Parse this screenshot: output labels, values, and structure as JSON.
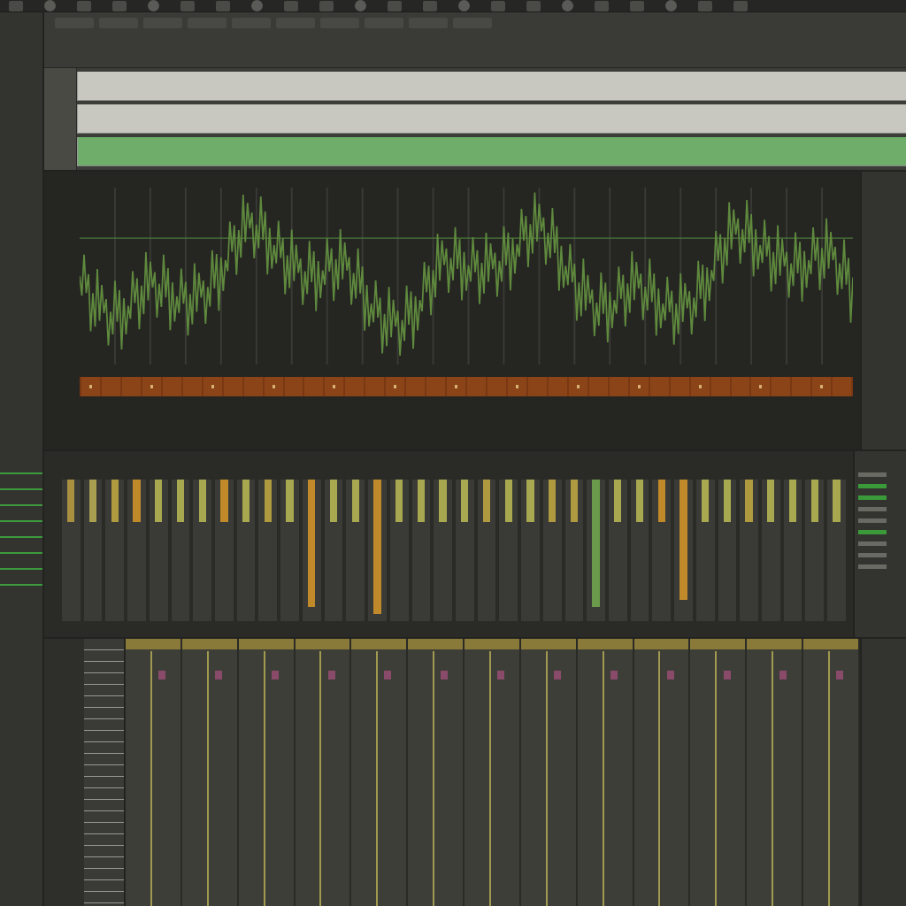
{
  "arrangement": {
    "lanes": [
      {
        "color": "#c8c8c0"
      },
      {
        "color": "#c8c8c0"
      },
      {
        "color": "#6fae6a"
      }
    ]
  },
  "mixer": {
    "channels": [
      {
        "level": 0.3,
        "color": "#a89040"
      },
      {
        "level": 0.3,
        "color": "#a8a050"
      },
      {
        "level": 0.3,
        "color": "#b09a40"
      },
      {
        "level": 0.3,
        "color": "#c08a2a"
      },
      {
        "level": 0.3,
        "color": "#a8a850"
      },
      {
        "level": 0.3,
        "color": "#a8a850"
      },
      {
        "level": 0.3,
        "color": "#a8a850"
      },
      {
        "level": 0.3,
        "color": "#c08a2a"
      },
      {
        "level": 0.3,
        "color": "#a8a850"
      },
      {
        "level": 0.3,
        "color": "#b09a40"
      },
      {
        "level": 0.3,
        "color": "#a8a850"
      },
      {
        "level": 0.9,
        "color": "#c08a2a"
      },
      {
        "level": 0.3,
        "color": "#a8a850"
      },
      {
        "level": 0.3,
        "color": "#a8a850"
      },
      {
        "level": 0.95,
        "color": "#c08a2a"
      },
      {
        "level": 0.3,
        "color": "#a8a850"
      },
      {
        "level": 0.3,
        "color": "#a8a850"
      },
      {
        "level": 0.3,
        "color": "#a8a850"
      },
      {
        "level": 0.3,
        "color": "#a8a850"
      },
      {
        "level": 0.3,
        "color": "#b09a40"
      },
      {
        "level": 0.3,
        "color": "#a8a850"
      },
      {
        "level": 0.3,
        "color": "#a8a850"
      },
      {
        "level": 0.3,
        "color": "#b09a40"
      },
      {
        "level": 0.3,
        "color": "#b09a40"
      },
      {
        "level": 0.9,
        "color": "#6a9a4a"
      },
      {
        "level": 0.3,
        "color": "#a8a850"
      },
      {
        "level": 0.3,
        "color": "#a8a850"
      },
      {
        "level": 0.3,
        "color": "#c08a2a"
      },
      {
        "level": 0.85,
        "color": "#c08a2a"
      },
      {
        "level": 0.3,
        "color": "#a8a850"
      },
      {
        "level": 0.3,
        "color": "#a8a850"
      },
      {
        "level": 0.3,
        "color": "#b09a40"
      },
      {
        "level": 0.3,
        "color": "#a8a850"
      },
      {
        "level": 0.3,
        "color": "#a8a850"
      },
      {
        "level": 0.3,
        "color": "#a8a850"
      },
      {
        "level": 0.3,
        "color": "#a8a850"
      }
    ]
  },
  "side_list": {
    "items": [
      {
        "selected": false
      },
      {
        "selected": true
      },
      {
        "selected": true
      },
      {
        "selected": false
      },
      {
        "selected": false
      },
      {
        "selected": true
      },
      {
        "selected": false
      },
      {
        "selected": false
      },
      {
        "selected": false
      }
    ]
  }
}
